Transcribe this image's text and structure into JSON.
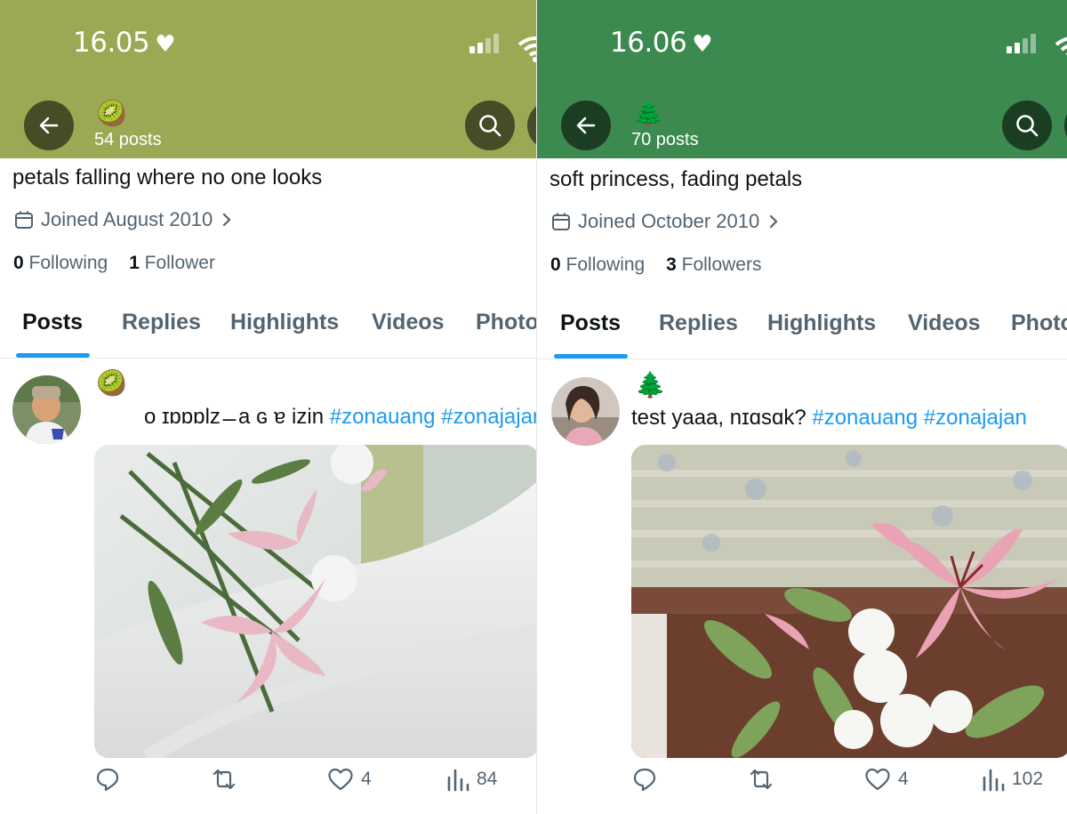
{
  "screens": [
    {
      "header_color": "#9aaa54",
      "time": "16.05",
      "header_emoji": "🥝",
      "posts_count": "54 posts",
      "bio": "petals falling where no one looks",
      "joined": "Joined August 2010",
      "following_count": "0",
      "following_label": "Following",
      "followers_count": "1",
      "followers_label": "Follower",
      "tabs": [
        "Posts",
        "Replies",
        "Highlights",
        "Videos",
        "Photos"
      ],
      "post": {
        "emoji": "🥝",
        "text": "o ɪɒɒɒlᴢ ̵ ̵  a ɢ ɐ izin",
        "hashtags": "#zonauang #zonajajan",
        "replies": "",
        "reposts": "",
        "likes": "4",
        "views": "84"
      }
    },
    {
      "header_color": "#3c8a4f",
      "time": "16.06",
      "header_emoji": "🌲",
      "posts_count": "70 posts",
      "bio": "soft princess, fading petals",
      "joined": "Joined October 2010",
      "following_count": "0",
      "following_label": "Following",
      "followers_count": "3",
      "followers_label": "Followers",
      "tabs": [
        "Posts",
        "Replies",
        "Highlights",
        "Videos",
        "Photos"
      ],
      "post": {
        "emoji": "🌲",
        "text": "test yaaa, nɪɑsɑk?",
        "hashtags": "#zonauang #zonajajan",
        "replies": "",
        "reposts": "",
        "likes": "4",
        "views": "102"
      }
    }
  ],
  "colors": {
    "text_primary": "#0f1419",
    "text_secondary": "#536471",
    "accent": "#1d9bf0"
  },
  "icons": [
    "back-arrow-icon",
    "search-icon",
    "calendar-icon",
    "chevron-right-icon",
    "reply-icon",
    "repost-icon",
    "like-icon",
    "views-icon",
    "heart-icon",
    "signal-icon",
    "wifi-icon"
  ]
}
